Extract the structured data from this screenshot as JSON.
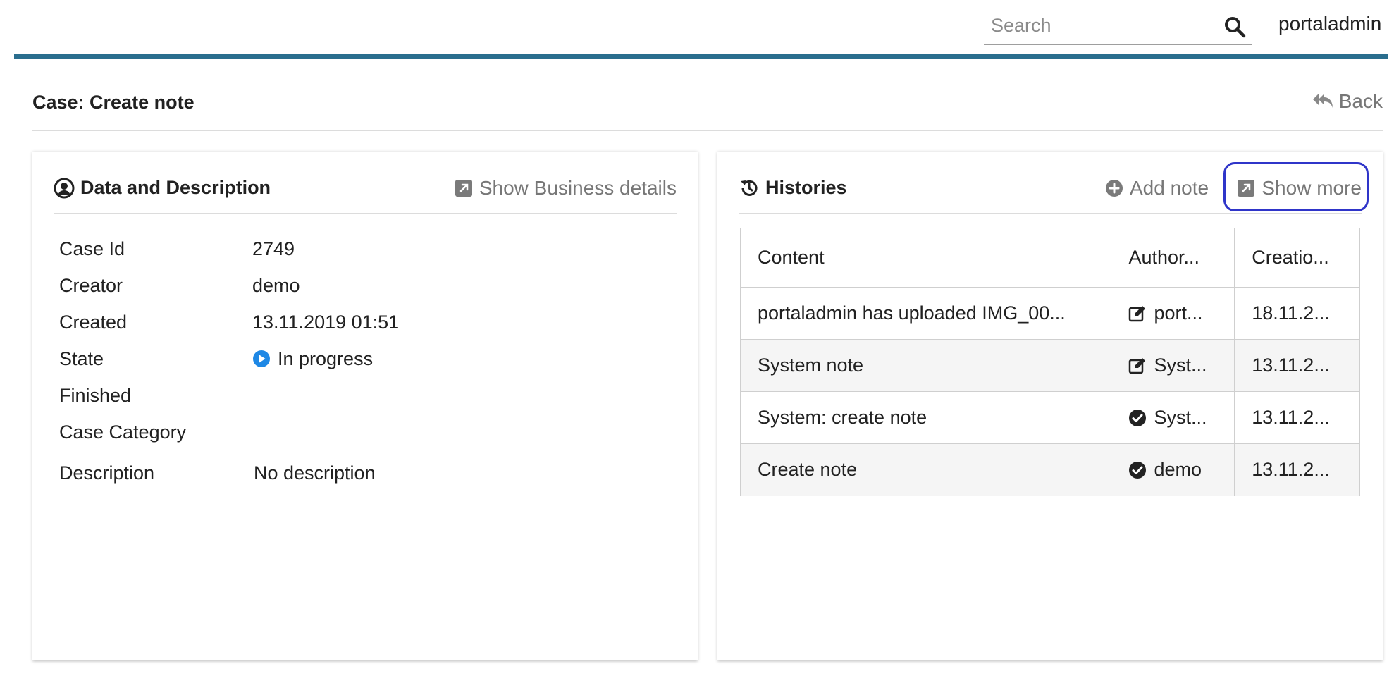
{
  "header": {
    "search": {
      "placeholder": "Search",
      "value": ""
    },
    "username": "portaladmin",
    "accent_color": "#2a6e8e"
  },
  "page": {
    "title": "Case:  Create note",
    "back_label": "Back"
  },
  "data_panel": {
    "title": "Data and Description",
    "business_link": "Show Business details",
    "rows": [
      {
        "label": "Case Id",
        "value": "2749"
      },
      {
        "label": "Creator",
        "value": "demo"
      },
      {
        "label": "Created",
        "value": "13.11.2019 01:51"
      },
      {
        "label": "State",
        "value": "In progress",
        "icon": "play-circle-icon",
        "icon_color": "#1e88e5"
      },
      {
        "label": "Finished",
        "value": ""
      },
      {
        "label": "Case Category",
        "value": ""
      },
      {
        "label": "Description",
        "value": "No description"
      }
    ]
  },
  "history_panel": {
    "title": "Histories",
    "add_note_label": "Add note",
    "show_more_label": "Show more",
    "columns": [
      "Content",
      "Author...",
      "Creatio..."
    ],
    "rows": [
      {
        "content": "portaladmin has uploaded IMG_00...",
        "author_icon": "edit-note-icon",
        "author": "port...",
        "created": "18.11.2..."
      },
      {
        "content": "System note",
        "author_icon": "edit-note-icon",
        "author": "Syst...",
        "created": "13.11.2..."
      },
      {
        "content": "System: create note",
        "author_icon": "check-circle-icon",
        "author": "Syst...",
        "created": "13.11.2..."
      },
      {
        "content": "Create note",
        "author_icon": "check-circle-icon",
        "author": "demo",
        "created": "13.11.2..."
      }
    ],
    "highlight_color": "#2f35c9"
  }
}
